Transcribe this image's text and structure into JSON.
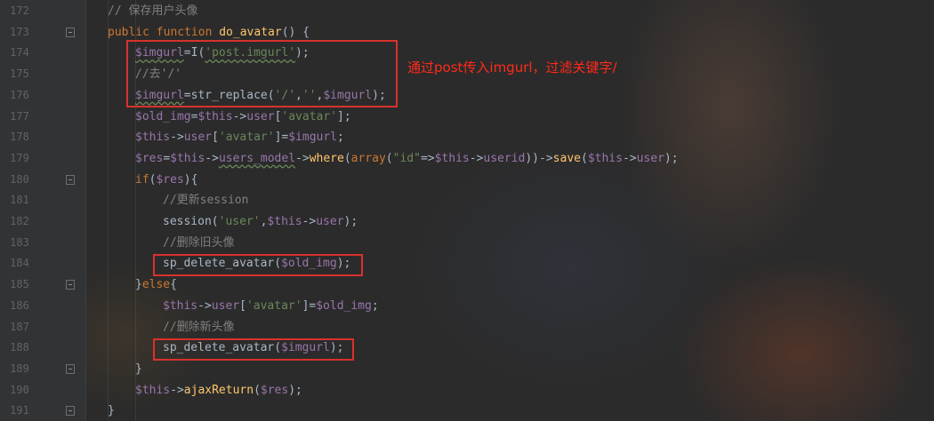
{
  "lines": [
    {
      "num": "172",
      "indent": 0,
      "tokens": [
        {
          "t": "// 保存用户头像",
          "c": "cmt"
        }
      ]
    },
    {
      "num": "173",
      "indent": 0,
      "fold": true,
      "tokens": [
        {
          "t": "public function ",
          "c": "kw"
        },
        {
          "t": "do_avatar",
          "c": "fn"
        },
        {
          "t": "() {",
          "c": "plain"
        }
      ]
    },
    {
      "num": "174",
      "indent": 1,
      "tokens": [
        {
          "t": "$imgurl",
          "c": "var squiggle"
        },
        {
          "t": "=I(",
          "c": "plain"
        },
        {
          "t": "'post.imgurl'",
          "c": "str squiggle"
        },
        {
          "t": ");",
          "c": "plain"
        }
      ]
    },
    {
      "num": "175",
      "indent": 1,
      "tokens": [
        {
          "t": "//去'/'",
          "c": "cmt"
        }
      ]
    },
    {
      "num": "176",
      "indent": 1,
      "tokens": [
        {
          "t": "$imgurl",
          "c": "var squiggle"
        },
        {
          "t": "=str_replace(",
          "c": "plain"
        },
        {
          "t": "'/'",
          "c": "str"
        },
        {
          "t": ",",
          "c": "plain"
        },
        {
          "t": "''",
          "c": "str"
        },
        {
          "t": ",",
          "c": "plain"
        },
        {
          "t": "$imgurl",
          "c": "var"
        },
        {
          "t": ");",
          "c": "plain"
        }
      ]
    },
    {
      "num": "177",
      "indent": 1,
      "tokens": [
        {
          "t": "$old_img",
          "c": "var"
        },
        {
          "t": "=",
          "c": "plain"
        },
        {
          "t": "$this",
          "c": "var"
        },
        {
          "t": "->",
          "c": "plain"
        },
        {
          "t": "user",
          "c": "var"
        },
        {
          "t": "[",
          "c": "plain"
        },
        {
          "t": "'avatar'",
          "c": "str"
        },
        {
          "t": "];",
          "c": "plain"
        }
      ]
    },
    {
      "num": "178",
      "indent": 1,
      "tokens": [
        {
          "t": "$this",
          "c": "var"
        },
        {
          "t": "->",
          "c": "plain"
        },
        {
          "t": "user",
          "c": "var"
        },
        {
          "t": "[",
          "c": "plain"
        },
        {
          "t": "'avatar'",
          "c": "str"
        },
        {
          "t": "]=",
          "c": "plain"
        },
        {
          "t": "$imgurl",
          "c": "var"
        },
        {
          "t": ";",
          "c": "plain"
        }
      ]
    },
    {
      "num": "179",
      "indent": 1,
      "tokens": [
        {
          "t": "$res",
          "c": "var"
        },
        {
          "t": "=",
          "c": "plain"
        },
        {
          "t": "$this",
          "c": "var"
        },
        {
          "t": "->",
          "c": "plain"
        },
        {
          "t": "users_model",
          "c": "var squiggle"
        },
        {
          "t": "->",
          "c": "plain"
        },
        {
          "t": "where",
          "c": "fn"
        },
        {
          "t": "(",
          "c": "plain"
        },
        {
          "t": "array",
          "c": "kw"
        },
        {
          "t": "(",
          "c": "plain"
        },
        {
          "t": "\"id\"",
          "c": "str"
        },
        {
          "t": "=>",
          "c": "plain"
        },
        {
          "t": "$this",
          "c": "var"
        },
        {
          "t": "->",
          "c": "plain"
        },
        {
          "t": "userid",
          "c": "var"
        },
        {
          "t": "))->",
          "c": "plain"
        },
        {
          "t": "save",
          "c": "fn"
        },
        {
          "t": "(",
          "c": "plain"
        },
        {
          "t": "$this",
          "c": "var"
        },
        {
          "t": "->",
          "c": "plain"
        },
        {
          "t": "user",
          "c": "var"
        },
        {
          "t": ");",
          "c": "plain"
        }
      ]
    },
    {
      "num": "180",
      "indent": 1,
      "fold": true,
      "tokens": [
        {
          "t": "if",
          "c": "kw"
        },
        {
          "t": "(",
          "c": "plain"
        },
        {
          "t": "$res",
          "c": "var"
        },
        {
          "t": "){",
          "c": "plain"
        }
      ]
    },
    {
      "num": "181",
      "indent": 2,
      "tokens": [
        {
          "t": "//更新session",
          "c": "cmt"
        }
      ]
    },
    {
      "num": "182",
      "indent": 2,
      "tokens": [
        {
          "t": "session(",
          "c": "plain"
        },
        {
          "t": "'user'",
          "c": "str"
        },
        {
          "t": ",",
          "c": "plain"
        },
        {
          "t": "$this",
          "c": "var"
        },
        {
          "t": "->",
          "c": "plain"
        },
        {
          "t": "user",
          "c": "var"
        },
        {
          "t": ");",
          "c": "plain"
        }
      ]
    },
    {
      "num": "183",
      "indent": 2,
      "tokens": [
        {
          "t": "//删除旧头像",
          "c": "cmt"
        }
      ]
    },
    {
      "num": "184",
      "indent": 2,
      "tokens": [
        {
          "t": "sp_delete_avatar(",
          "c": "plain"
        },
        {
          "t": "$old_img",
          "c": "var"
        },
        {
          "t": ");",
          "c": "plain"
        }
      ]
    },
    {
      "num": "185",
      "indent": 1,
      "fold": true,
      "tokens": [
        {
          "t": "}",
          "c": "plain"
        },
        {
          "t": "else",
          "c": "kw"
        },
        {
          "t": "{",
          "c": "plain"
        }
      ]
    },
    {
      "num": "186",
      "indent": 2,
      "tokens": [
        {
          "t": "$this",
          "c": "var"
        },
        {
          "t": "->",
          "c": "plain"
        },
        {
          "t": "user",
          "c": "var"
        },
        {
          "t": "[",
          "c": "plain"
        },
        {
          "t": "'avatar'",
          "c": "str"
        },
        {
          "t": "]=",
          "c": "plain"
        },
        {
          "t": "$old_img",
          "c": "var"
        },
        {
          "t": ";",
          "c": "plain"
        }
      ]
    },
    {
      "num": "187",
      "indent": 2,
      "tokens": [
        {
          "t": "//删除新头像",
          "c": "cmt"
        }
      ]
    },
    {
      "num": "188",
      "indent": 2,
      "tokens": [
        {
          "t": "sp_delete_avatar(",
          "c": "plain"
        },
        {
          "t": "$imgurl",
          "c": "var"
        },
        {
          "t": ");",
          "c": "plain"
        }
      ]
    },
    {
      "num": "189",
      "indent": 1,
      "fold": true,
      "tokens": [
        {
          "t": "}",
          "c": "plain"
        }
      ]
    },
    {
      "num": "190",
      "indent": 1,
      "tokens": [
        {
          "t": "$this",
          "c": "var"
        },
        {
          "t": "->",
          "c": "plain"
        },
        {
          "t": "ajaxReturn",
          "c": "fn"
        },
        {
          "t": "(",
          "c": "plain"
        },
        {
          "t": "$res",
          "c": "var"
        },
        {
          "t": ");",
          "c": "plain"
        }
      ]
    },
    {
      "num": "191",
      "indent": 0,
      "fold": true,
      "tokens": [
        {
          "t": "}",
          "c": "plain"
        }
      ]
    }
  ],
  "annotation": {
    "text": "通过post传入imgurl，过滤关键字/",
    "color": "#ff2a1a"
  },
  "colors": {
    "keyword": "#cc7832",
    "variable": "#9876aa",
    "string": "#6a8759",
    "function": "#ffc66d",
    "comment": "#808080",
    "highlight_box": "#d9312c"
  }
}
